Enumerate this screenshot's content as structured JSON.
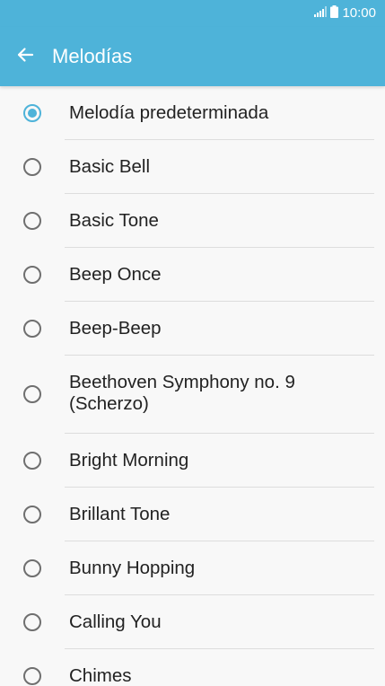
{
  "status_bar": {
    "time": "10:00",
    "signal_icon": "signal-icon",
    "battery_icon": "battery-icon"
  },
  "app_bar": {
    "back_icon": "arrow-left-icon",
    "title": "Melodías"
  },
  "colors": {
    "accent": "#4eb3d9",
    "background": "#f8f8f8",
    "text": "#222222",
    "divider": "#dddddd"
  },
  "ringtones": [
    {
      "label": "Melodía predeterminada",
      "selected": true
    },
    {
      "label": "Basic Bell",
      "selected": false
    },
    {
      "label": "Basic Tone",
      "selected": false
    },
    {
      "label": "Beep Once",
      "selected": false
    },
    {
      "label": "Beep-Beep",
      "selected": false
    },
    {
      "label": "Beethoven Symphony no. 9 (Scherzo)",
      "selected": false
    },
    {
      "label": "Bright Morning",
      "selected": false
    },
    {
      "label": "Brillant Tone",
      "selected": false
    },
    {
      "label": "Bunny Hopping",
      "selected": false
    },
    {
      "label": "Calling You",
      "selected": false
    },
    {
      "label": "Chimes",
      "selected": false
    }
  ]
}
